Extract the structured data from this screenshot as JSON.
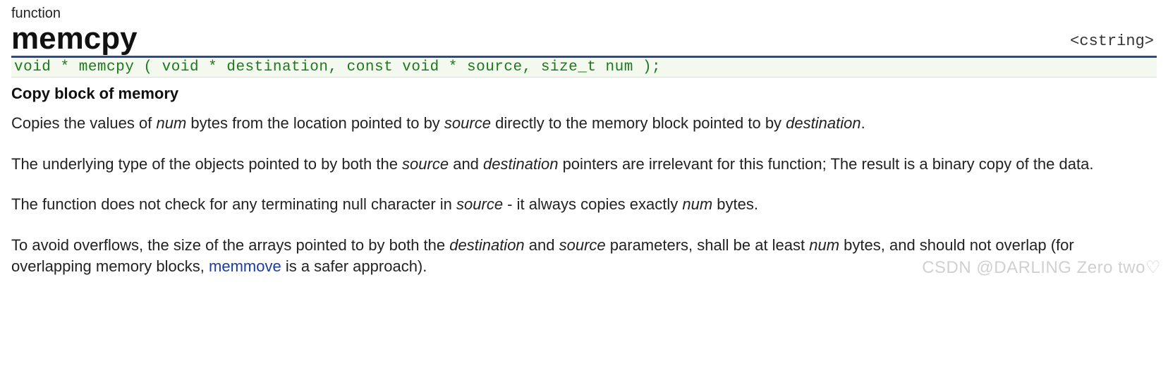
{
  "category": "function",
  "title": "memcpy",
  "header_include": "<cstring>",
  "signature": "void * memcpy ( void * destination, const void * source, size_t num );",
  "subtitle": "Copy block of memory",
  "paragraphs": {
    "p1_parts": {
      "t1": "Copies the values of ",
      "i1": "num",
      "t2": " bytes from the location pointed to by ",
      "i2": "source",
      "t3": " directly to the memory block pointed to by ",
      "i3": "destination",
      "t4": "."
    },
    "p2_parts": {
      "t1": "The underlying type of the objects pointed to by both the ",
      "i1": "source",
      "t2": " and ",
      "i2": "destination",
      "t3": " pointers are irrelevant for this function; The result is a binary copy of the data."
    },
    "p3_parts": {
      "t1": "The function does not check for any terminating null character in ",
      "i1": "source",
      "t2": " - it always copies exactly ",
      "i2": "num",
      "t3": " bytes."
    },
    "p4_parts": {
      "t1": "To avoid overflows, the size of the arrays pointed to by both the ",
      "i1": "destination",
      "t2": " and ",
      "i2": "source",
      "t3": " parameters, shall be at least ",
      "i3": "num",
      "t4": " bytes, and should not overlap (for overlapping memory blocks, ",
      "link": "memmove",
      "t5": " is a safer approach)."
    }
  },
  "watermark": "CSDN @DARLING Zero two♡"
}
